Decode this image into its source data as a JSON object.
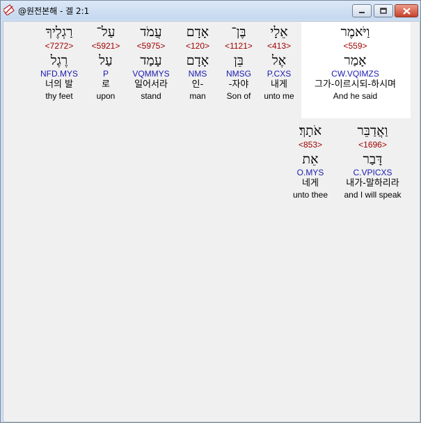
{
  "window": {
    "title": "@원전본해 - 겔 2:1",
    "controls": [
      "minimize-button",
      "maximize-button",
      "close-button"
    ]
  },
  "colors": {
    "strongs": "#a00000",
    "parsing": "#1a1ab0",
    "highlight": "#ffffff"
  },
  "rows": [
    {
      "words": [
        {
          "hebrew": "וַיֹּאמֶר",
          "strongs": "<559>",
          "root": "אָמַר",
          "parsing": "CW.VQIMZS",
          "korean": "그가-이르시되-하시며",
          "english": "And he said",
          "highlighted": true
        },
        {
          "hebrew": "אֵלָי",
          "strongs": "<413>",
          "root": "אֶל",
          "parsing": "P.CXS",
          "korean": "내게",
          "english": "unto me"
        },
        {
          "hebrew": "בֶּן־",
          "strongs": "<1121>",
          "root": "בֵּן",
          "parsing": "NMSG",
          "korean": "-자야",
          "english": "Son of"
        },
        {
          "hebrew": "אָדָם",
          "strongs": "<120>",
          "root": "אָדָם",
          "parsing": "NMS",
          "korean": "인-",
          "english": "man"
        },
        {
          "hebrew": "עֲמֹד",
          "strongs": "<5975>",
          "root": "עָמַד",
          "parsing": "VQMMYS",
          "korean": "일어서라",
          "english": "stand"
        },
        {
          "hebrew": "עַל־",
          "strongs": "<5921>",
          "root": "עַל",
          "parsing": "P",
          "korean": "로",
          "english": "upon"
        },
        {
          "hebrew": "רַגְלֶיךָ",
          "strongs": "<7272>",
          "root": "רֶגֶל",
          "parsing": "NFD.MYS",
          "korean": "너의 발",
          "english": "thy feet"
        }
      ]
    },
    {
      "words": [
        {
          "hebrew": "וַאֲדַבֵּר",
          "strongs": "<1696>",
          "root": "דָּבַר",
          "parsing": "C.VPICXS",
          "korean": "내가-말하리라",
          "english": "and I will speak"
        },
        {
          "hebrew": "אֹתָךְ׃",
          "strongs": "<853>",
          "root": "אֵת",
          "parsing": "O.MYS",
          "korean": "네게",
          "english": "unto thee"
        }
      ]
    }
  ]
}
